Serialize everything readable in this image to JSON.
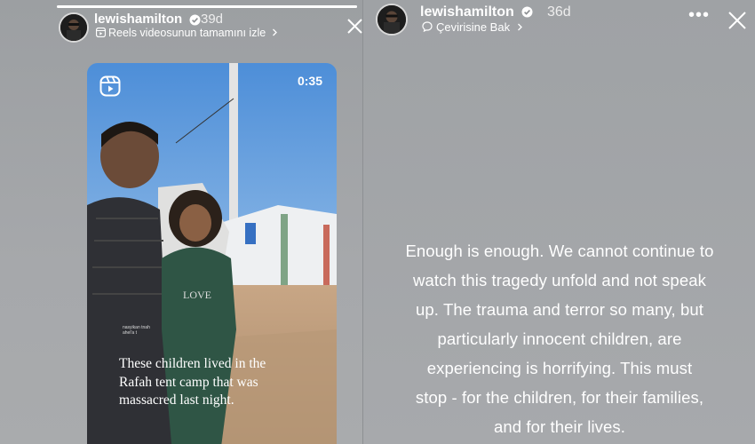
{
  "left_story": {
    "username": "lewishamilton",
    "age": "39d",
    "subline": "Reels videosunun tamamını izle",
    "video": {
      "duration": "0:35",
      "caption_lines": [
        "These children lived in the",
        "Rafah tent camp that was",
        "massacred last night."
      ],
      "watermark": "nasyikan tnah ahel'a t"
    },
    "icons": {
      "reels": "reels-icon",
      "close": "close-icon",
      "verified": "verified-badge-icon",
      "chevron": "chevron-right-icon"
    }
  },
  "right_story": {
    "username": "lewishamilton",
    "age": "36d",
    "subline": "Çevirisine Bak",
    "text_lines": [
      "Enough is enough. We cannot continue to",
      "watch this tragedy unfold and not speak",
      "up. The trauma and terror so many, but",
      "particularly innocent children, are",
      "experiencing is horrifying. This must",
      "stop - for the children, for their families,",
      "and for their lives."
    ],
    "icons": {
      "more": "more-options-icon",
      "close": "close-icon",
      "translate": "translate-icon",
      "verified": "verified-badge-icon",
      "chevron": "chevron-right-icon"
    }
  }
}
